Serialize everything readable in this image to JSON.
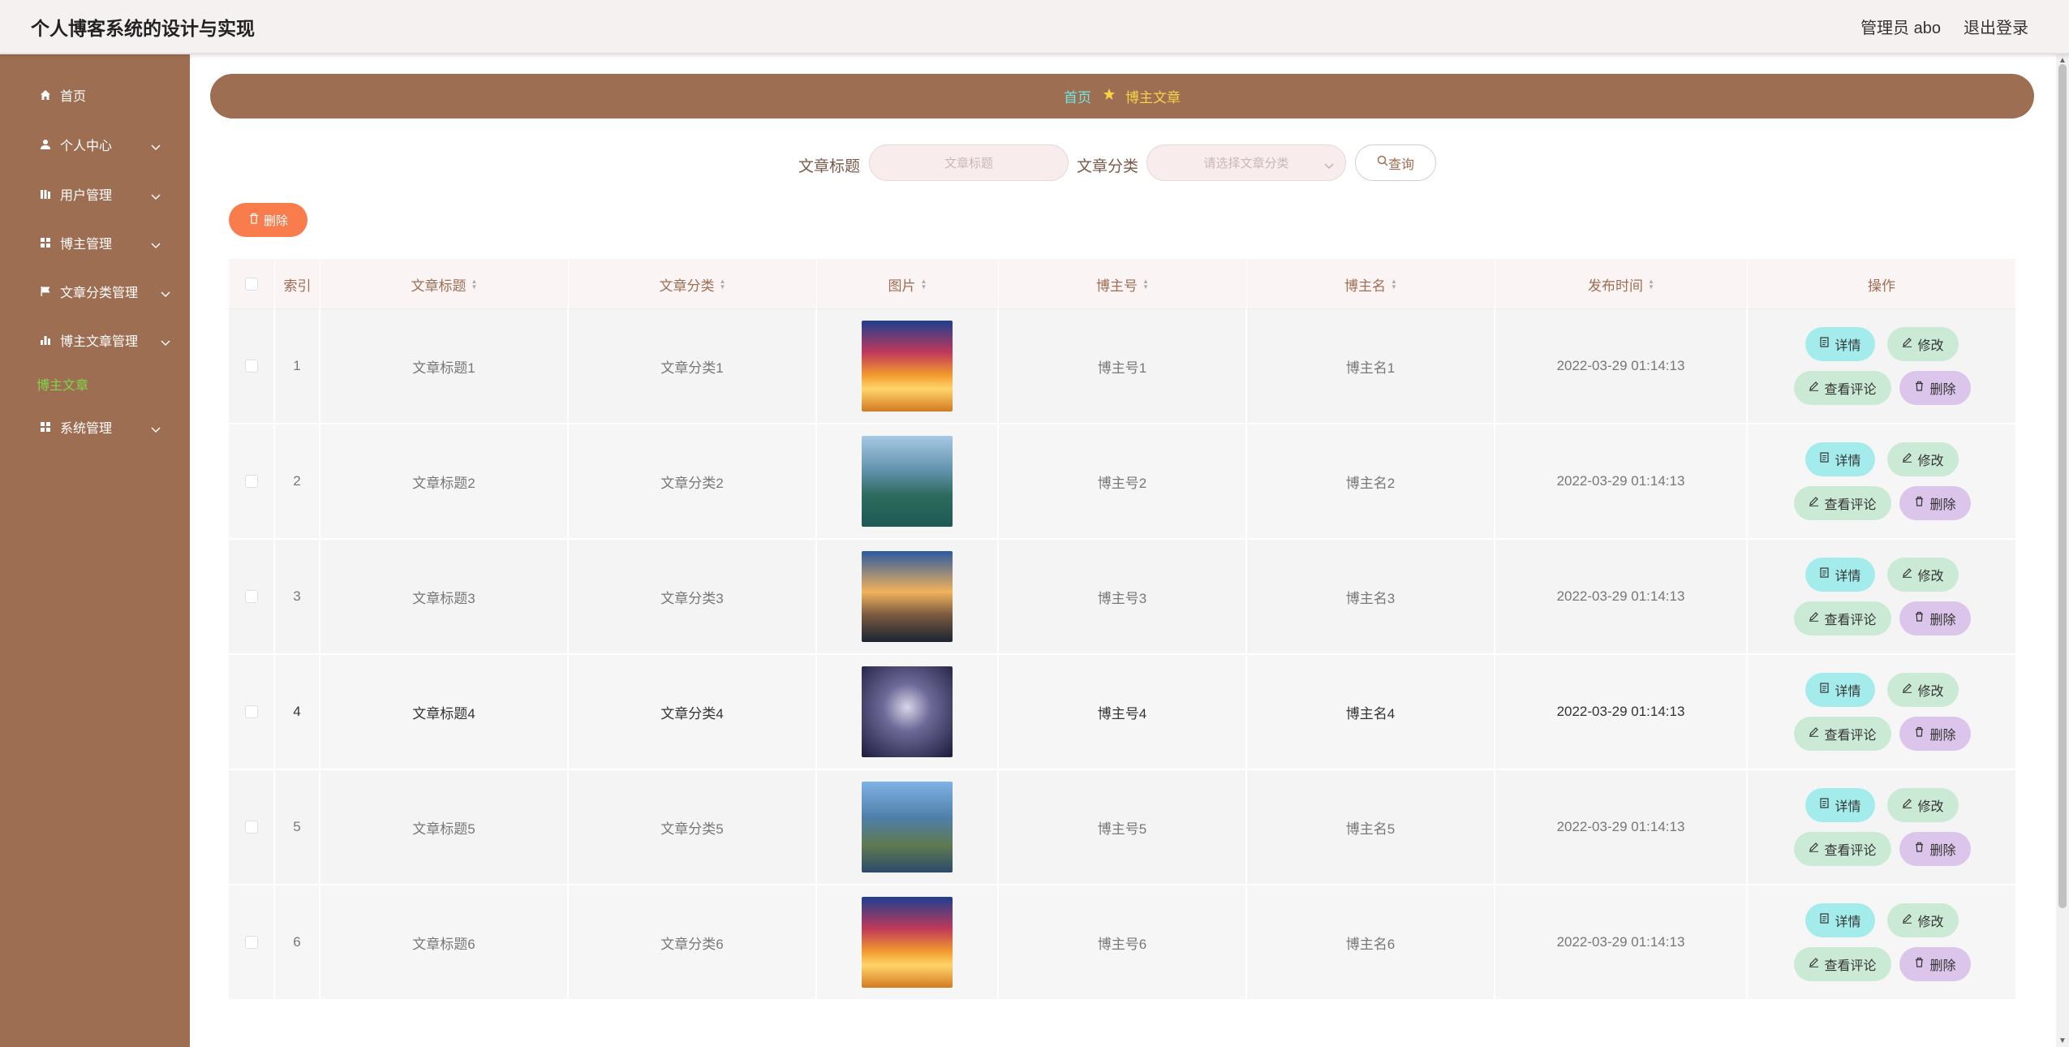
{
  "header": {
    "title": "个人博客系统的设计与实现",
    "user": "管理员 abo",
    "logout": "退出登录"
  },
  "sidebar": {
    "items": [
      {
        "label": "首页",
        "icon": "home-icon"
      },
      {
        "label": "个人中心",
        "icon": "user-icon"
      },
      {
        "label": "用户管理",
        "icon": "bars-icon"
      },
      {
        "label": "博主管理",
        "icon": "grid-icon"
      },
      {
        "label": "文章分类管理",
        "icon": "flag-icon"
      },
      {
        "label": "博主文章管理",
        "icon": "chart-icon"
      },
      {
        "label": "系统管理",
        "icon": "grid-icon"
      }
    ],
    "active_sub": "博主文章"
  },
  "breadcrumb": {
    "home": "首页",
    "current": "博主文章"
  },
  "search": {
    "title_label": "文章标题",
    "title_placeholder": "文章标题",
    "category_label": "文章分类",
    "category_placeholder": "请选择文章分类",
    "query_button": "查询"
  },
  "toolbar": {
    "delete_label": "删除"
  },
  "table": {
    "columns": [
      "索引",
      "文章标题",
      "文章分类",
      "图片",
      "博主号",
      "博主名",
      "发布时间",
      "操作"
    ],
    "rows": [
      {
        "index": "1",
        "title": "文章标题1",
        "category": "文章分类1",
        "blogger_no": "博主号1",
        "blogger_name": "博主名1",
        "time": "2022-03-29 01:14:13"
      },
      {
        "index": "2",
        "title": "文章标题2",
        "category": "文章分类2",
        "blogger_no": "博主号2",
        "blogger_name": "博主名2",
        "time": "2022-03-29 01:14:13"
      },
      {
        "index": "3",
        "title": "文章标题3",
        "category": "文章分类3",
        "blogger_no": "博主号3",
        "blogger_name": "博主名3",
        "time": "2022-03-29 01:14:13"
      },
      {
        "index": "4",
        "title": "文章标题4",
        "category": "文章分类4",
        "blogger_no": "博主号4",
        "blogger_name": "博主名4",
        "time": "2022-03-29 01:14:13"
      },
      {
        "index": "5",
        "title": "文章标题5",
        "category": "文章分类5",
        "blogger_no": "博主号5",
        "blogger_name": "博主名5",
        "time": "2022-03-29 01:14:13"
      },
      {
        "index": "6",
        "title": "文章标题6",
        "category": "文章分类6",
        "blogger_no": "博主号6",
        "blogger_name": "博主名6",
        "time": "2022-03-29 01:14:13"
      }
    ],
    "actions": {
      "detail": "详情",
      "edit": "修改",
      "comments": "查看评论",
      "delete": "删除"
    }
  },
  "colors": {
    "sidebar": "#9e6e52",
    "accent_orange": "#f97d4c",
    "detail_btn": "#a4ecec",
    "edit_btn": "#cbead6",
    "delete_btn": "#dcc5ea"
  }
}
